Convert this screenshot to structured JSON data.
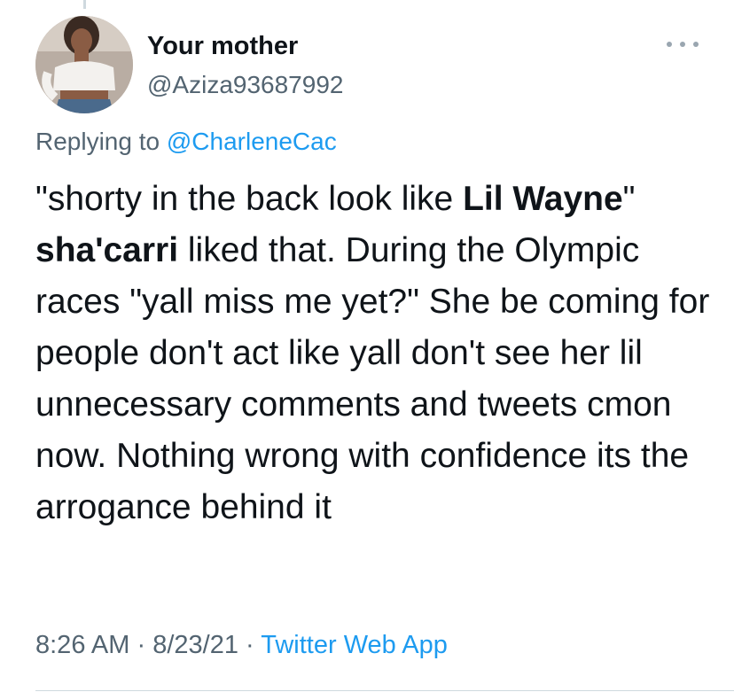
{
  "tweet": {
    "author_name": "Your mother",
    "author_handle": "@Aziza93687992",
    "replying_prefix": "Replying to",
    "replying_to": "@CharleneCac",
    "text_parts": [
      "\"shorty in the back look like ",
      "Lil Wayne",
      "\" ",
      "sha'carri",
      " liked that. During the Olympic races \"yall miss me yet?\" She be coming for people don't act like yall don't see her lil unnecessary comments and tweets cmon now. Nothing wrong with confidence its the arrogance behind it"
    ],
    "time": "8:26 AM",
    "separator": "·",
    "date": "8/23/21",
    "source": "Twitter Web App"
  },
  "icons": {
    "more": "more-horizontal-icon",
    "avatar": "profile-photo"
  },
  "colors": {
    "text": "#0f1419",
    "secondary": "#536471",
    "link": "#1d9bf0",
    "divider": "#cfd9de"
  }
}
